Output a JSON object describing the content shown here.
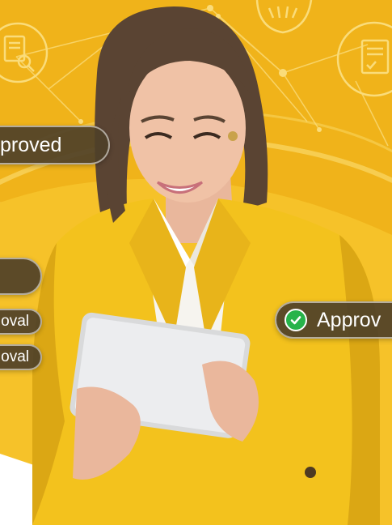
{
  "badges": {
    "approved_left": "proved",
    "approval_1": "oval",
    "approval_2": "oval",
    "approved_right": "Approv"
  },
  "icons": {
    "right_badge_icon": "check-circle-icon",
    "bg_icons": [
      "document-search-icon",
      "hands-icon",
      "certificate-icon"
    ]
  },
  "colors": {
    "background_yellow": "#f2b61a",
    "arc_yellow": "#f7c52c",
    "chip_bg": "#4e4028",
    "check_green": "#27b34a",
    "blazer_yellow": "#f3c21d",
    "shirt_white": "#f6f4ef"
  }
}
